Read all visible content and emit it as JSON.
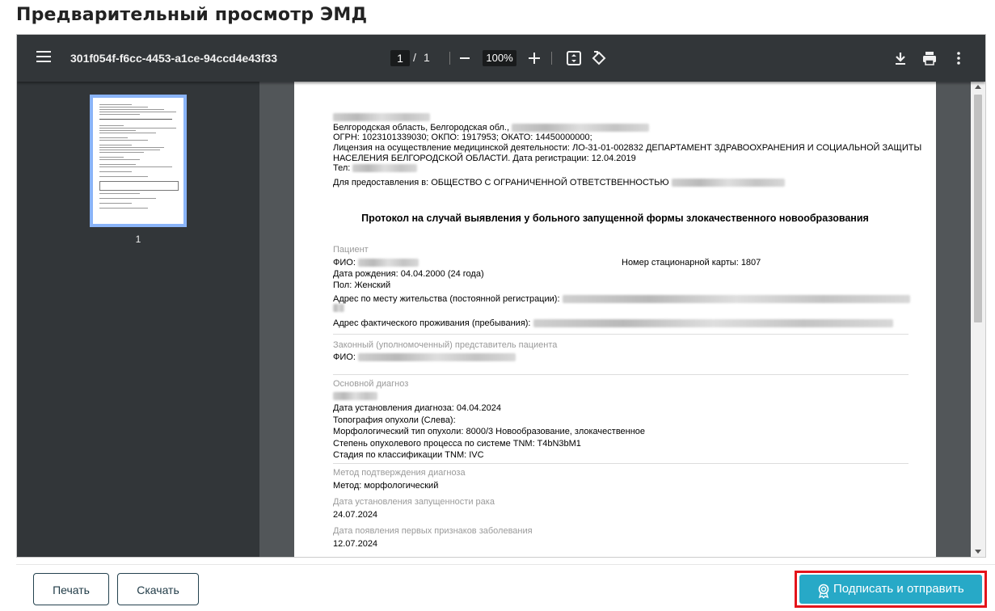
{
  "page": {
    "title": "Предварительный просмотр ЭМД"
  },
  "viewer": {
    "file_name": "301f054f-f6cc-4453-a1ce-94ccd4e43f33",
    "current_page": "1",
    "page_separator": "/",
    "total_pages": "1",
    "zoom": "100%",
    "thumbnail_label": "1",
    "icons": [
      "menu-icon",
      "zoom-out-icon",
      "zoom-in-icon",
      "fit-page-icon",
      "rotate-icon",
      "download-icon",
      "print-icon",
      "more-vert-icon"
    ]
  },
  "document": {
    "org_address": "Белгородская область, Белгородская обл.,",
    "ogrn_line": "ОГРН: 1023101339030; ОКПО: 1917953; ОКАТО: 14450000000;",
    "license_line1": "Лицензия на осуществление медицинской деятельности: ЛО-31-01-002832 ДЕПАРТАМЕНТ ЗДРАВООХРАНЕНИЯ И СОЦИАЛЬНОЙ ЗАЩИТЫ",
    "license_line2": "НАСЕЛЕНИЯ БЕЛГОРОДСКОЙ ОБЛАСТИ. Дата регистрации: 12.04.2019",
    "tel_label": "Тел:",
    "for_line": "Для предоставления в: ОБЩЕСТВО С ОГРАНИЧЕННОЙ ОТВЕТСТВЕННОСТЬЮ",
    "title": "Протокол на случай выявления у больного запущенной формы злокачественного новообразования",
    "patient": {
      "section": "Пациент",
      "fio_label": "ФИО:",
      "card_label": "Номер стационарной карты: 1807",
      "birth": "Дата рождения: 04.04.2000 (24 года)",
      "sex": "Пол: Женский",
      "reg_address_label": "Адрес по месту жительства (постоянной регистрации):",
      "actual_address_label": "Адрес фактического проживания (пребывания):"
    },
    "representative": {
      "section": "Законный (уполномоченный) представитель пациента",
      "fio_label": "ФИО:"
    },
    "diagnosis": {
      "section": "Основной диагноз",
      "date": "Дата установления диагноза: 04.04.2024",
      "topography": "Топография опухоли (Слева):",
      "morphology": "Морфологический тип опухоли: 8000/3 Новообразование, злокачественное",
      "tnm": "Степень опухолевого процесса по системе TNM: T4bN3bM1",
      "stage": "Стадия по классификации TNM: IVC"
    },
    "confirmation": {
      "section": "Метод подтверждения диагноза",
      "method": "Метод: морфологический"
    },
    "neglect_date": {
      "section": "Дата установления запущенности рака",
      "value": "24.07.2024"
    },
    "first_signs": {
      "section": "Дата появления первых признаков заболевания",
      "value": "12.07.2024"
    }
  },
  "footer": {
    "print_label": "Печать",
    "download_label": "Скачать",
    "sign_label": "Подписать и отправить"
  },
  "colors": {
    "accent": "#27a9c7",
    "highlight": "#e4141b",
    "toolbar": "#323639",
    "viewer_bg": "#525659"
  }
}
